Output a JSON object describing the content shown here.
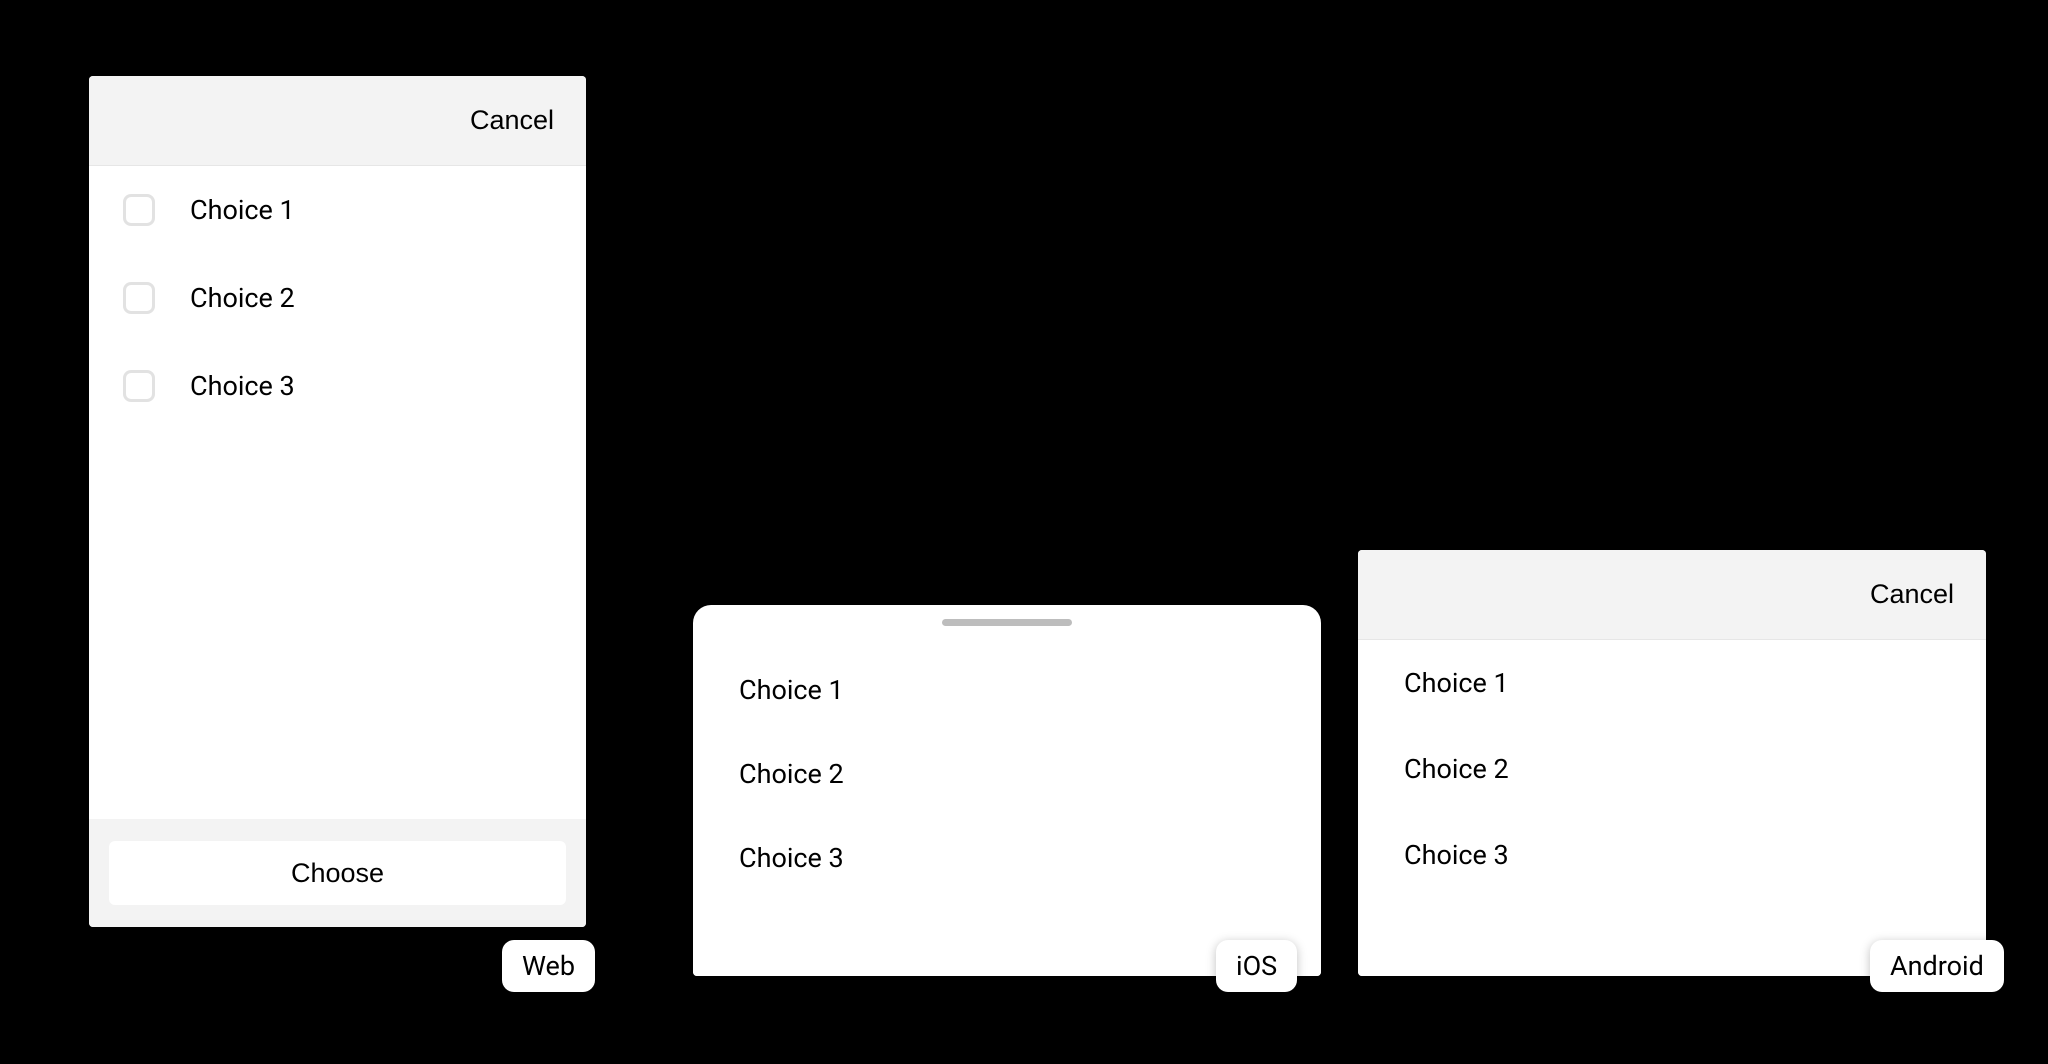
{
  "web": {
    "cancel_label": "Cancel",
    "choices": [
      "Choice 1",
      "Choice 2",
      "Choice 3"
    ],
    "choose_label": "Choose"
  },
  "ios": {
    "choices": [
      "Choice 1",
      "Choice 2",
      "Choice 3"
    ]
  },
  "android": {
    "cancel_label": "Cancel",
    "choices": [
      "Choice 1",
      "Choice 2",
      "Choice 3"
    ]
  },
  "badges": {
    "web": "Web",
    "ios": "iOS",
    "android": "Android"
  }
}
